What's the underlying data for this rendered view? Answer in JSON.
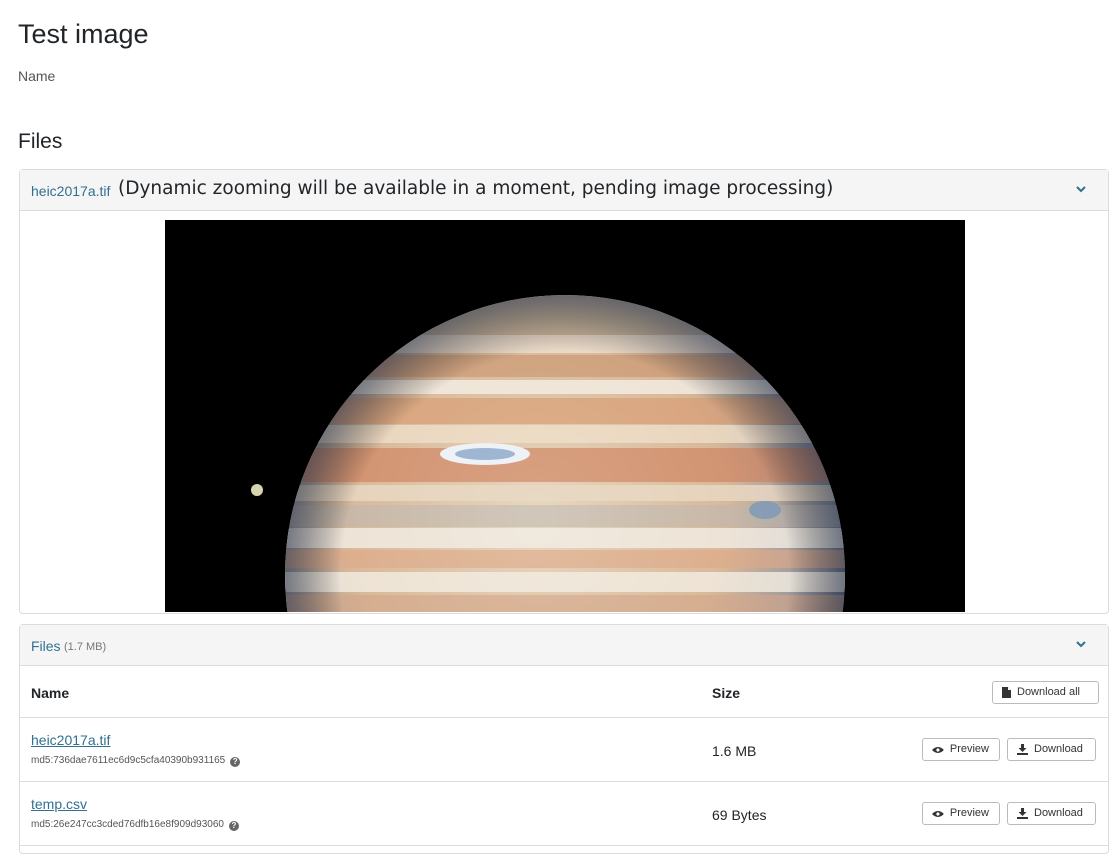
{
  "page": {
    "title": "Test image",
    "name_label": "Name",
    "files_heading": "Files"
  },
  "preview": {
    "filename": "heic2017a.tif",
    "note": "(Dynamic zooming will be available in a moment, pending image processing)",
    "toggle_icon": "chevron-down-icon"
  },
  "files_panel": {
    "title": "Files",
    "total_size": "(1.7 MB)",
    "toggle_icon": "chevron-down-icon",
    "columns": {
      "name": "Name",
      "size": "Size"
    },
    "download_all_label": "Download all",
    "rows": [
      {
        "name": "heic2017a.tif",
        "md5": "md5:736dae7611ec6d9c5cfa40390b931165",
        "size": "1.6 MB",
        "preview_label": "Preview",
        "download_label": "Download"
      },
      {
        "name": "temp.csv",
        "md5": "md5:26e247cc3cded76dfb16e8f909d93060",
        "size": "69 Bytes",
        "preview_label": "Preview",
        "download_label": "Download"
      }
    ]
  },
  "colors": {
    "link": "#31708f",
    "panel_header": "#f5f5f5",
    "border": "#dcdcdc"
  }
}
